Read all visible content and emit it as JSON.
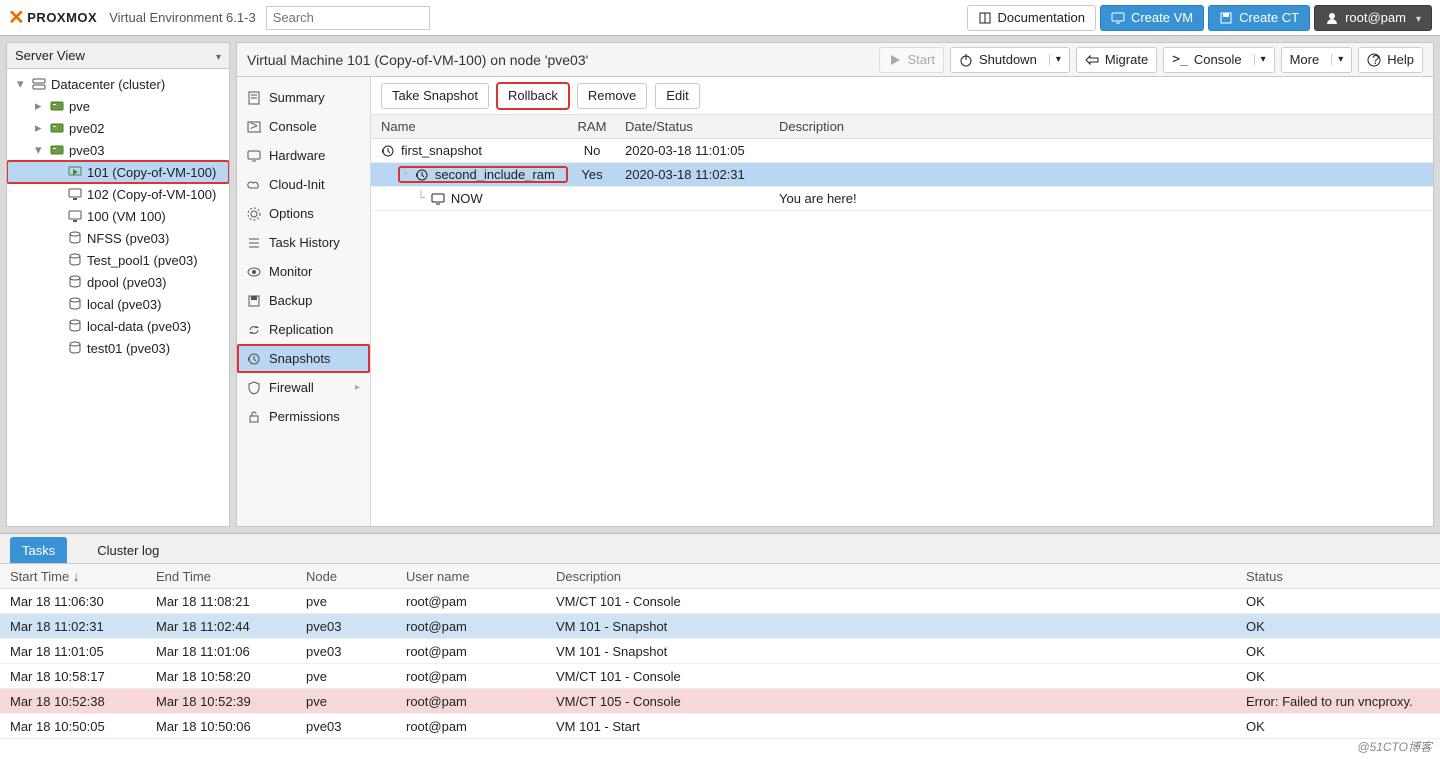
{
  "header": {
    "product": "PROXMOX",
    "version_label": "Virtual Environment 6.1-3",
    "search_placeholder": "Search",
    "documentation": "Documentation",
    "create_vm": "Create VM",
    "create_ct": "Create CT",
    "user": "root@pam"
  },
  "sidebar": {
    "view_label": "Server View",
    "tree": [
      {
        "label": "Datacenter (cluster)",
        "icon": "server-icon",
        "indent": 0,
        "expanded": true
      },
      {
        "label": "pve",
        "icon": "node-icon",
        "indent": 1,
        "expanded": false
      },
      {
        "label": "pve02",
        "icon": "node-icon",
        "indent": 1,
        "expanded": false
      },
      {
        "label": "pve03",
        "icon": "node-icon",
        "indent": 1,
        "expanded": true
      },
      {
        "label": "101 (Copy-of-VM-100)",
        "icon": "vm-running-icon",
        "indent": 2,
        "selected": true,
        "highlight_box": true
      },
      {
        "label": "102 (Copy-of-VM-100)",
        "icon": "vm-icon",
        "indent": 2
      },
      {
        "label": "100 (VM 100)",
        "icon": "vm-icon",
        "indent": 2
      },
      {
        "label": "NFSS (pve03)",
        "icon": "storage-icon",
        "indent": 2
      },
      {
        "label": "Test_pool1 (pve03)",
        "icon": "storage-icon",
        "indent": 2
      },
      {
        "label": "dpool (pve03)",
        "icon": "storage-icon",
        "indent": 2
      },
      {
        "label": "local (pve03)",
        "icon": "storage-icon",
        "indent": 2
      },
      {
        "label": "local-data (pve03)",
        "icon": "storage-icon",
        "indent": 2
      },
      {
        "label": "test01 (pve03)",
        "icon": "storage-icon",
        "indent": 2
      }
    ]
  },
  "main": {
    "title": "Virtual Machine 101 (Copy-of-VM-100) on node 'pve03'",
    "actions": {
      "start": "Start",
      "shutdown": "Shutdown",
      "migrate": "Migrate",
      "console": "Console",
      "more": "More",
      "help": "Help"
    },
    "subnav": [
      {
        "label": "Summary",
        "icon": "notes-icon"
      },
      {
        "label": "Console",
        "icon": "terminal-icon"
      },
      {
        "label": "Hardware",
        "icon": "display-icon"
      },
      {
        "label": "Cloud-Init",
        "icon": "cloud-icon"
      },
      {
        "label": "Options",
        "icon": "gear-icon"
      },
      {
        "label": "Task History",
        "icon": "list-icon"
      },
      {
        "label": "Monitor",
        "icon": "eye-icon"
      },
      {
        "label": "Backup",
        "icon": "save-icon"
      },
      {
        "label": "Replication",
        "icon": "sync-icon"
      },
      {
        "label": "Snapshots",
        "icon": "history-icon",
        "selected": true,
        "highlight_box": true
      },
      {
        "label": "Firewall",
        "icon": "shield-icon",
        "has_submenu": true
      },
      {
        "label": "Permissions",
        "icon": "unlock-icon"
      }
    ],
    "snapshots": {
      "toolbar": {
        "take": "Take Snapshot",
        "rollback": "Rollback",
        "remove": "Remove",
        "edit": "Edit"
      },
      "columns": {
        "name": "Name",
        "ram": "RAM",
        "date": "Date/Status",
        "desc": "Description"
      },
      "rows": [
        {
          "name": "first_snapshot",
          "ram": "No",
          "date": "2020-03-18 11:01:05",
          "desc": "",
          "depth": 0,
          "icon": "history-icon"
        },
        {
          "name": "second_include_ram",
          "ram": "Yes",
          "date": "2020-03-18 11:02:31",
          "desc": "",
          "depth": 1,
          "icon": "history-icon",
          "selected": true,
          "highlight_box": true
        },
        {
          "name": "NOW",
          "ram": "",
          "date": "",
          "desc": "You are here!",
          "depth": 2,
          "icon": "display-icon"
        }
      ]
    }
  },
  "log": {
    "tabs": {
      "tasks": "Tasks",
      "cluster_log": "Cluster log"
    },
    "columns": {
      "start": "Start Time",
      "end": "End Time",
      "node": "Node",
      "user": "User name",
      "desc": "Description",
      "status": "Status"
    },
    "sort_indicator": "↓",
    "rows": [
      {
        "start": "Mar 18 11:06:30",
        "end": "Mar 18 11:08:21",
        "node": "pve",
        "user": "root@pam",
        "desc": "VM/CT 101 - Console",
        "status": "OK"
      },
      {
        "start": "Mar 18 11:02:31",
        "end": "Mar 18 11:02:44",
        "node": "pve03",
        "user": "root@pam",
        "desc": "VM 101 - Snapshot",
        "status": "OK",
        "tone": "blue"
      },
      {
        "start": "Mar 18 11:01:05",
        "end": "Mar 18 11:01:06",
        "node": "pve03",
        "user": "root@pam",
        "desc": "VM 101 - Snapshot",
        "status": "OK"
      },
      {
        "start": "Mar 18 10:58:17",
        "end": "Mar 18 10:58:20",
        "node": "pve",
        "user": "root@pam",
        "desc": "VM/CT 101 - Console",
        "status": "OK"
      },
      {
        "start": "Mar 18 10:52:38",
        "end": "Mar 18 10:52:39",
        "node": "pve",
        "user": "root@pam",
        "desc": "VM/CT 105 - Console",
        "status": "Error: Failed to run vncproxy.",
        "tone": "pink"
      },
      {
        "start": "Mar 18 10:50:05",
        "end": "Mar 18 10:50:06",
        "node": "pve03",
        "user": "root@pam",
        "desc": "VM 101 - Start",
        "status": "OK"
      }
    ]
  },
  "watermark": "@51CTO博客"
}
